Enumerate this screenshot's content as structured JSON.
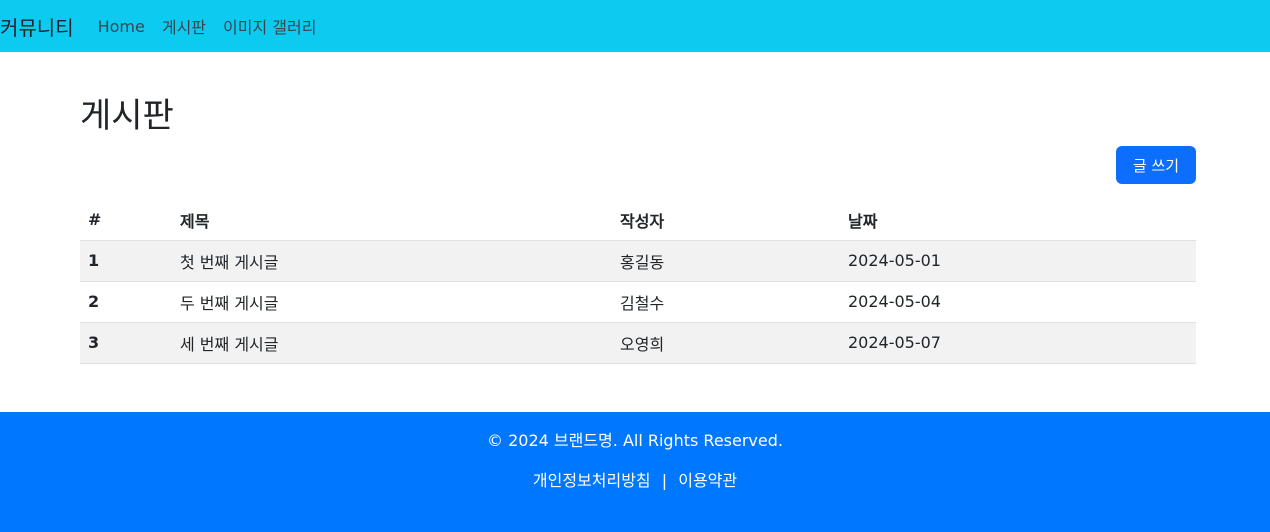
{
  "navbar": {
    "brand": "커뮤니티",
    "links": [
      {
        "label": "Home"
      },
      {
        "label": "게시판"
      },
      {
        "label": "이미지 갤러리"
      }
    ],
    "background": "#0dcaf0"
  },
  "main": {
    "page_title": "게시판",
    "write_button_label": "글 쓰기",
    "table": {
      "headers": [
        "#",
        "제목",
        "작성자",
        "날짜"
      ],
      "rows": [
        {
          "num": "1",
          "title": "첫 번째 게시글",
          "author": "홍길동",
          "date": "2024-05-01"
        },
        {
          "num": "2",
          "title": "두 번째 게시글",
          "author": "김철수",
          "date": "2024-05-04"
        },
        {
          "num": "3",
          "title": "세 번째 게시글",
          "author": "오영희",
          "date": "2024-05-07"
        }
      ]
    }
  },
  "footer": {
    "copyright": "© 2024 브랜드명. All Rights Reserved.",
    "privacy_link": "개인정보처리방침",
    "separator": "|",
    "terms_link": "이용약관",
    "background": "#0077ff"
  }
}
